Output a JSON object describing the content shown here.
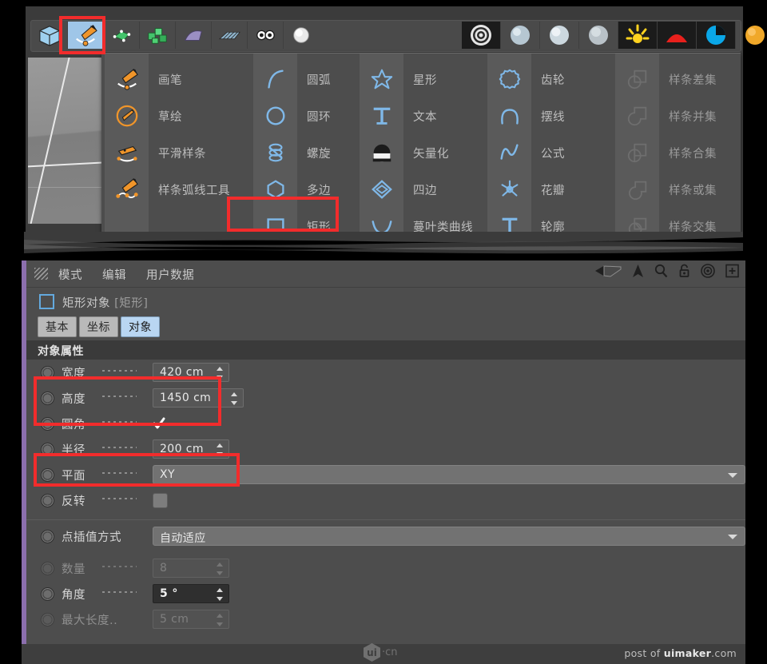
{
  "app": "Cinema 4D",
  "toolbar": {
    "primary_tools": [
      {
        "name": "cube-tool",
        "icon": "cube-icon",
        "selected": false
      },
      {
        "name": "spline-pen-tool",
        "icon": "pen-spline-icon",
        "selected": true
      },
      {
        "name": "generator-tool",
        "icon": "green-generator-icon",
        "selected": false
      },
      {
        "name": "array-tool",
        "icon": "green-cubes-icon",
        "selected": false
      },
      {
        "name": "deformer-tool",
        "icon": "purple-bend-icon",
        "selected": false
      },
      {
        "name": "scene-tool",
        "icon": "floor-grid-icon",
        "selected": false
      },
      {
        "name": "camera-tool",
        "icon": "two-eyes-icon",
        "selected": false
      },
      {
        "name": "light-tool",
        "icon": "light-sphere-icon",
        "selected": false
      }
    ],
    "material_tools": [
      {
        "name": "material-target",
        "icon": "target-rings-icon",
        "dark": true
      },
      {
        "name": "material-glass",
        "icon": "glass-sphere-icon",
        "dark": false
      },
      {
        "name": "material-clear",
        "icon": "clear-sphere-icon",
        "dark": false
      },
      {
        "name": "material-grey",
        "icon": "grey-sphere-icon",
        "dark": false
      },
      {
        "name": "sun-tool",
        "icon": "sun-icon",
        "dark": true
      },
      {
        "name": "sky-tool",
        "icon": "red-arc-icon",
        "dark": true
      },
      {
        "name": "physical-sky-tool",
        "icon": "blue-pie-icon",
        "dark": true
      },
      {
        "name": "sphere-object-tool",
        "icon": "orange-ball-icon",
        "dark": false
      }
    ]
  },
  "flyout_menu": {
    "columns": [
      {
        "name": "spline-tools-column",
        "items": [
          {
            "label": "画笔",
            "icon": "pen-icon"
          },
          {
            "label": "草绘",
            "icon": "sketch-pen-icon"
          },
          {
            "label": "平滑样条",
            "icon": "smooth-spline-icon"
          },
          {
            "label": "样条弧线工具",
            "icon": "spline-arc-tool-icon"
          }
        ]
      },
      {
        "name": "primitive-splines-column",
        "items": [
          {
            "label": "圆弧",
            "icon": "arc-icon"
          },
          {
            "label": "圆环",
            "icon": "circle-icon"
          },
          {
            "label": "螺旋",
            "icon": "helix-icon"
          },
          {
            "label": "多边",
            "icon": "ngon-icon"
          },
          {
            "label": "矩形",
            "icon": "rectangle-icon",
            "highlighted": true
          }
        ]
      },
      {
        "name": "shape-splines-column",
        "items": [
          {
            "label": "星形",
            "icon": "star-icon"
          },
          {
            "label": "文本",
            "icon": "text-t-icon"
          },
          {
            "label": "矢量化",
            "icon": "vectorize-icon"
          },
          {
            "label": "四边",
            "icon": "quad-diamond-icon"
          },
          {
            "label": "蔓叶类曲线",
            "icon": "cissoid-icon"
          }
        ]
      },
      {
        "name": "math-splines-column",
        "items": [
          {
            "label": "齿轮",
            "icon": "gear-icon"
          },
          {
            "label": "摆线",
            "icon": "cycloid-icon"
          },
          {
            "label": "公式",
            "icon": "formula-icon"
          },
          {
            "label": "花瓣",
            "icon": "flower-icon"
          },
          {
            "label": "轮廓",
            "icon": "profile-icon"
          }
        ]
      },
      {
        "name": "spline-booleans-column",
        "items": [
          {
            "label": "样条差集",
            "icon": "spline-subtract-icon"
          },
          {
            "label": "样条并集",
            "icon": "spline-union-icon"
          },
          {
            "label": "样条合集",
            "icon": "spline-merge-icon"
          },
          {
            "label": "样条或集",
            "icon": "spline-or-icon"
          },
          {
            "label": "样条交集",
            "icon": "spline-intersect-icon"
          }
        ]
      }
    ]
  },
  "attribute_manager": {
    "menubar": [
      "模式",
      "编辑",
      "用户数据"
    ],
    "header_icons": [
      "back-arrow-icon",
      "up-arrow-icon",
      "search-icon",
      "lock-icon",
      "target-icon",
      "add-icon"
    ],
    "object_title": "矩形对象",
    "object_type": "[矩形]",
    "tabs": [
      {
        "label": "基本",
        "active": false
      },
      {
        "label": "坐标",
        "active": false
      },
      {
        "label": "对象",
        "active": true
      }
    ],
    "section_title": "对象属性",
    "properties": [
      {
        "name": "width",
        "label": "宽度",
        "value": "420 cm",
        "control": "spinner",
        "enabled": true,
        "highlighted": true
      },
      {
        "name": "height",
        "label": "高度",
        "value": "1450 cm",
        "control": "spinner",
        "enabled": true,
        "highlighted": true
      },
      {
        "name": "rounding",
        "label": "圆角",
        "value": "",
        "control": "checkbox",
        "enabled": true,
        "checked": true
      },
      {
        "name": "radius",
        "label": "半径",
        "value": "200 cm",
        "control": "spinner",
        "enabled": true,
        "highlighted": true
      },
      {
        "name": "plane",
        "label": "平面",
        "value": "XY",
        "control": "dropdown",
        "enabled": true
      },
      {
        "name": "reverse",
        "label": "反转",
        "value": "",
        "control": "toggle",
        "enabled": true
      },
      {
        "name": "interpolation",
        "label": "点插值方式",
        "value": "自动适应",
        "control": "dropdown",
        "enabled": true
      },
      {
        "name": "number",
        "label": "数量",
        "value": "8",
        "control": "spinner",
        "enabled": false
      },
      {
        "name": "angle",
        "label": "角度",
        "value": "5 °",
        "control": "spinner",
        "enabled": true,
        "dark": true
      },
      {
        "name": "max-length",
        "label": "最大长度..",
        "value": "5 cm",
        "control": "spinner",
        "enabled": false
      }
    ]
  },
  "watermark": {
    "right": "post of ",
    "right_brand": "uimaker",
    "right_tld": ".com",
    "logo_letter": "ui",
    "logo_suffix": "·cn"
  },
  "colors": {
    "panel_bg": "#4d4d4d",
    "menu_bg": "#4d4d4d",
    "stripe_bg": "#5a5a5a",
    "highlight_red": "#f22c2c",
    "accent_blue": "#63a9de",
    "tab_active": "#b9d6f2",
    "purple_edge": "#8c6fae",
    "icon_orange": "#f0952a",
    "icon_green": "#43c46b"
  }
}
